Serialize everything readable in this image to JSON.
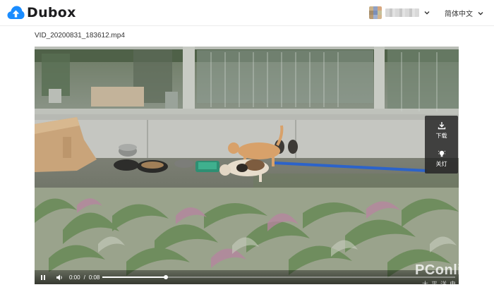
{
  "app": {
    "logo_text": "Dubox",
    "brand_color": "#1a8cff"
  },
  "header": {
    "user": {
      "avatar": "avatar-icon",
      "username": ""
    },
    "language": "简体中文"
  },
  "file": {
    "name": "VID_20200831_183612.mp4"
  },
  "player": {
    "side_actions": [
      {
        "label": "下载",
        "icon": "download-icon"
      },
      {
        "label": "关灯",
        "icon": "lightbulb-icon"
      }
    ],
    "current_time": "0:00",
    "separator": "/",
    "duration": "0:08",
    "progress": 0.18,
    "state": "playing"
  },
  "watermark": {
    "main": "PConline",
    "sub": "太平洋电脑网"
  }
}
